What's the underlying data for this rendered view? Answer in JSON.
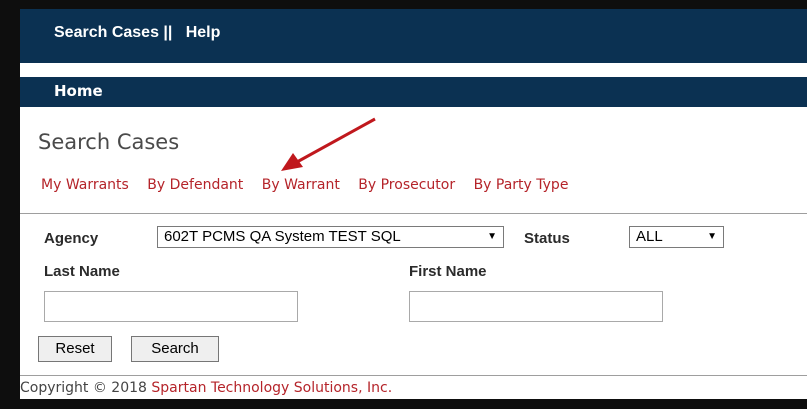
{
  "nav": {
    "search_cases": "Search Cases ||",
    "help": "Help"
  },
  "home": "Home",
  "page_title": "Search Cases",
  "tabs": [
    "My Warrants",
    "By Defendant",
    "By Warrant",
    "By Prosecutor",
    "By Party Type"
  ],
  "form": {
    "agency_label": "Agency",
    "agency_value": "602T PCMS QA System TEST SQL",
    "status_label": "Status",
    "status_value": "ALL",
    "last_name_label": "Last Name",
    "last_name_value": "",
    "first_name_label": "First Name",
    "first_name_value": ""
  },
  "buttons": {
    "reset": "Reset",
    "search": "Search"
  },
  "footer": {
    "copyright": "Copyright © 2018 ",
    "company": "Spartan Technology Solutions, Inc."
  },
  "colors": {
    "header_bg": "#0b3152",
    "link": "#b5242a",
    "annotation_arrow": "#c0181d"
  }
}
